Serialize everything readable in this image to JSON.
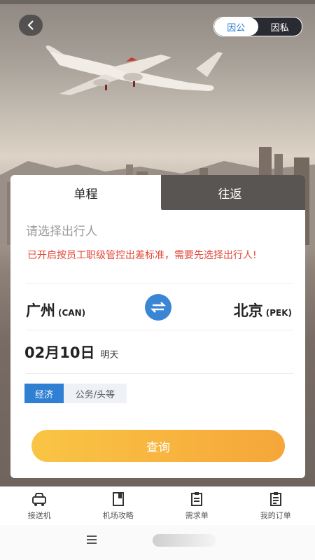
{
  "header": {
    "mode_switch": {
      "options": [
        "因公",
        "因私"
      ],
      "selected": "因公"
    }
  },
  "booking_card": {
    "tabs": [
      {
        "label": "单程",
        "active": true
      },
      {
        "label": "往返",
        "active": false
      }
    ],
    "traveler_placeholder": "请选择出行人",
    "warning_text": "已开启按员工职级管控出差标准，需要先选择出行人!",
    "origin": {
      "city": "广州",
      "code": "(CAN)"
    },
    "destination": {
      "city": "北京",
      "code": "(PEK)"
    },
    "date": {
      "value": "02月10日",
      "relative": "明天"
    },
    "cabin_classes": [
      {
        "label": "经济",
        "selected": true
      },
      {
        "label": "公务/头等",
        "selected": false
      }
    ],
    "search_label": "查询"
  },
  "bottom_nav": [
    {
      "label": "接送机",
      "icon": "car-icon"
    },
    {
      "label": "机场攻略",
      "icon": "book-icon"
    },
    {
      "label": "需求单",
      "icon": "clipboard-icon"
    },
    {
      "label": "我的订单",
      "icon": "order-icon"
    }
  ],
  "colors": {
    "accent_blue": "#2f7fd2",
    "warning_red": "#e2473a",
    "button_gradient_start": "#f9c545",
    "button_gradient_end": "#f6a63a"
  }
}
